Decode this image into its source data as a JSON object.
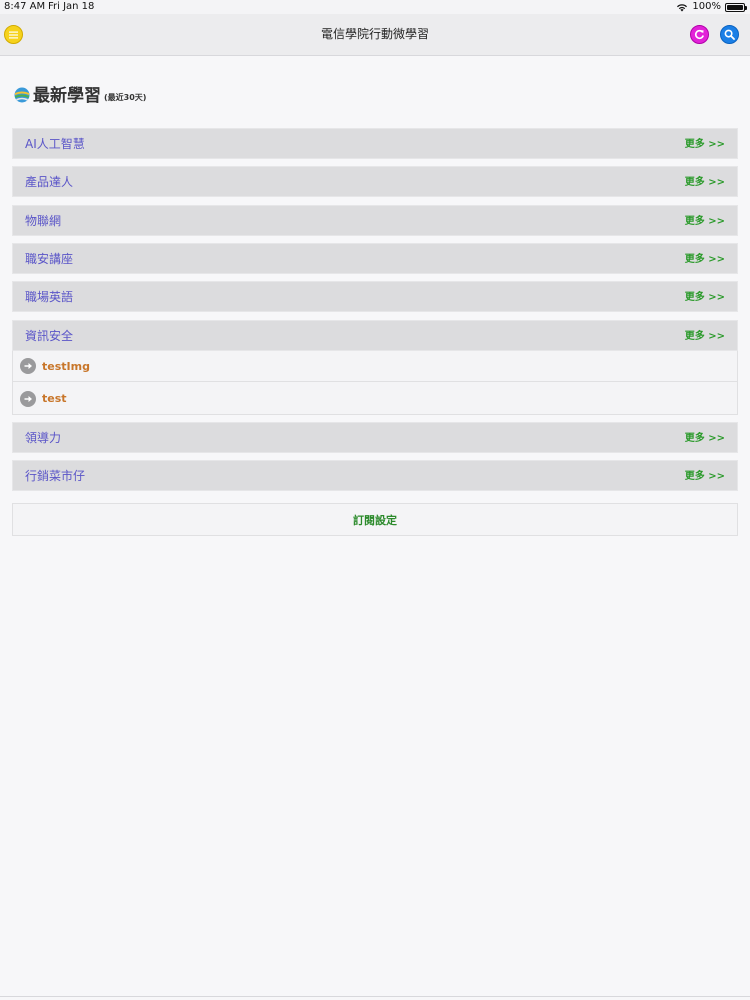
{
  "status": {
    "time": "8:47 AM",
    "date": "Fri Jan 18",
    "battery": "100%"
  },
  "nav": {
    "title": "電信學院行動微學習",
    "left_icon": "menu-icon",
    "right_icons": [
      "refresh-icon",
      "search-icon"
    ]
  },
  "heading": {
    "title": "最新學習",
    "subtitle": "(最近30天)"
  },
  "more_label": "更多 >>",
  "categories": [
    {
      "label": "AI人工智慧"
    },
    {
      "label": "產品達人"
    },
    {
      "label": "物聯網"
    },
    {
      "label": "職安講座"
    },
    {
      "label": "職場英語"
    },
    {
      "label": "資訊安全",
      "items": [
        "testImg",
        "test"
      ]
    },
    {
      "label": "領導力"
    },
    {
      "label": "行銷菜市仔"
    }
  ],
  "subscribe_label": "訂閱設定",
  "colors": {
    "category_text": "#5a55c8",
    "more_text": "#2b9a2b",
    "item_text": "#c8762a",
    "menu_button": "#f6d21c",
    "refresh_button": "#e222d8",
    "search_button": "#1b7fe6"
  }
}
